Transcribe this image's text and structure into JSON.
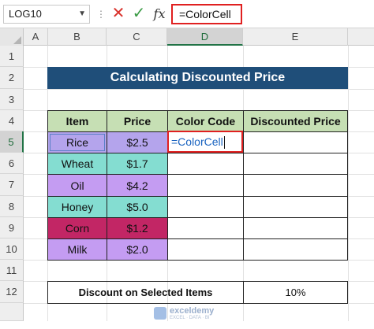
{
  "formula_bar": {
    "name_box": "LOG10",
    "dropdown_icon": "chevron-down-icon",
    "more_icon": "vertical-dots-icon",
    "cancel_icon": "close-x-icon",
    "enter_icon": "checkmark-icon",
    "fx_label": "fx",
    "formula": "=ColorCell"
  },
  "columns": [
    "A",
    "B",
    "C",
    "D",
    "E"
  ],
  "active_column": "D",
  "rows": [
    "1",
    "2",
    "3",
    "4",
    "5",
    "6",
    "7",
    "8",
    "9",
    "10",
    "11",
    "12"
  ],
  "active_row": "5",
  "sheet": {
    "title": "Calculating Discounted Price",
    "headers": [
      "Item",
      "Price",
      "Color Code",
      "Discounted Price"
    ],
    "items": [
      {
        "item": "Rice",
        "price": "$2.5",
        "color": "#b4a4ec"
      },
      {
        "item": "Wheat",
        "price": "$1.7",
        "color": "#84ddd1"
      },
      {
        "item": "Oil",
        "price": "$4.2",
        "color": "#c49cf2"
      },
      {
        "item": "Honey",
        "price": "$5.0",
        "color": "#84ddd1"
      },
      {
        "item": "Corn",
        "price": "$1.2",
        "color": "#c22665"
      },
      {
        "item": "Milk",
        "price": "$2.0",
        "color": "#c49cf2"
      }
    ],
    "editing_cell_text": "=ColorCell",
    "discount_label": "Discount on Selected Items",
    "discount_value": "10%"
  },
  "watermark": {
    "name": "exceldemy",
    "tagline": "EXCEL · DATA · BI"
  },
  "colors": {
    "title_bg": "#1f4e79",
    "header_bg": "#c6dfb4",
    "highlight_border": "#e02020"
  }
}
